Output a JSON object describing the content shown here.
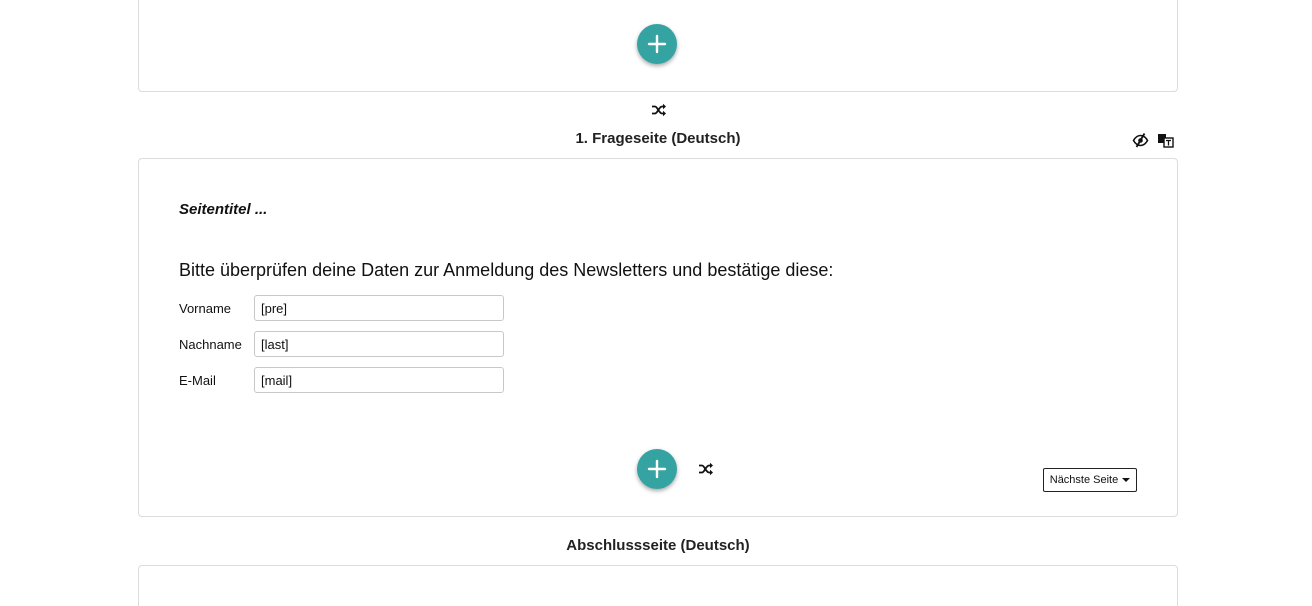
{
  "sections": {
    "question_page_title": "1. Frageseite (Deutsch)",
    "closing_page_title": "Abschlussseite (Deutsch)"
  },
  "page": {
    "title_placeholder": "Seitentitel ...",
    "intro_text": "Bitte überprüfen deine Daten zur Anmeldung des Newsletters und bestätige diese:",
    "fields": [
      {
        "label": "Vorname",
        "value": "[pre]"
      },
      {
        "label": "Nachname",
        "value": "[last]"
      },
      {
        "label": "E-Mail",
        "value": "[mail]"
      }
    ],
    "next_select": {
      "selected": "Nächste Seite"
    }
  },
  "icons": {
    "add": "plus-icon",
    "shuffle": "shuffle-icon",
    "visibility": "eye-slash-icon",
    "translate": "translate-icon"
  },
  "colors": {
    "accent": "#36a3a3",
    "border": "#dcdcdc"
  }
}
